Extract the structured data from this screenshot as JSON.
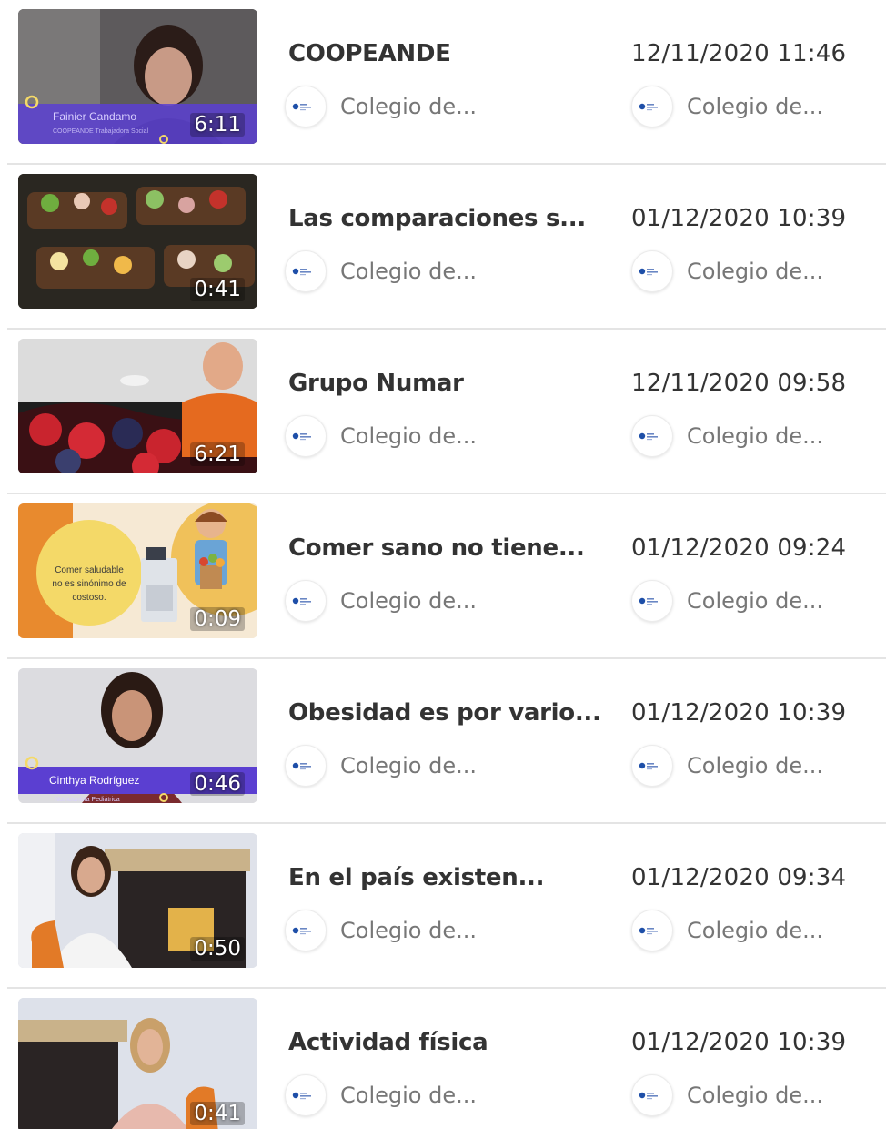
{
  "videos": [
    {
      "title": "COOPEANDE",
      "duration": "6:11",
      "date": "12/11/2020 11:46",
      "channel": "Colegio de...",
      "channel2": "Colegio de...",
      "overlay_name": "Fainier Candamo",
      "overlay_role": "COOPEANDE Trabajadora Social"
    },
    {
      "title": "Las comparaciones s...",
      "duration": "0:41",
      "date": "01/12/2020 10:39",
      "channel": "Colegio de...",
      "channel2": "Colegio de..."
    },
    {
      "title": "Grupo Numar",
      "duration": "6:21",
      "date": "12/11/2020 09:58",
      "channel": "Colegio de...",
      "channel2": "Colegio de..."
    },
    {
      "title": "Comer sano no tiene...",
      "duration": "0:09",
      "date": "01/12/2020 09:24",
      "channel": "Colegio de...",
      "channel2": "Colegio de...",
      "overlay_text_1": "Comer saludable",
      "overlay_text_2": "no es sinónimo de",
      "overlay_text_3": "costoso."
    },
    {
      "title": "Obesidad es por vario...",
      "duration": "0:46",
      "date": "01/12/2020 10:39",
      "channel": "Colegio de...",
      "channel2": "Colegio de...",
      "overlay_name": "Cinthya Rodríguez",
      "overlay_role": "Nutricionista Pediátrica"
    },
    {
      "title": "En el país existen...",
      "duration": "0:50",
      "date": "01/12/2020 09:34",
      "channel": "Colegio de...",
      "channel2": "Colegio de..."
    },
    {
      "title": "Actividad física",
      "duration": "0:41",
      "date": "01/12/2020 10:39",
      "channel": "Colegio de...",
      "channel2": "Colegio de..."
    }
  ],
  "colors": {
    "accent_purple": "#6a3de8",
    "accent_orange": "#e88a2e",
    "accent_yellow": "#f4d968",
    "text_primary": "#333333",
    "text_secondary": "#777777",
    "divider": "#e4e4e4"
  },
  "icons": {
    "channel_avatar": "college-logo-icon"
  }
}
